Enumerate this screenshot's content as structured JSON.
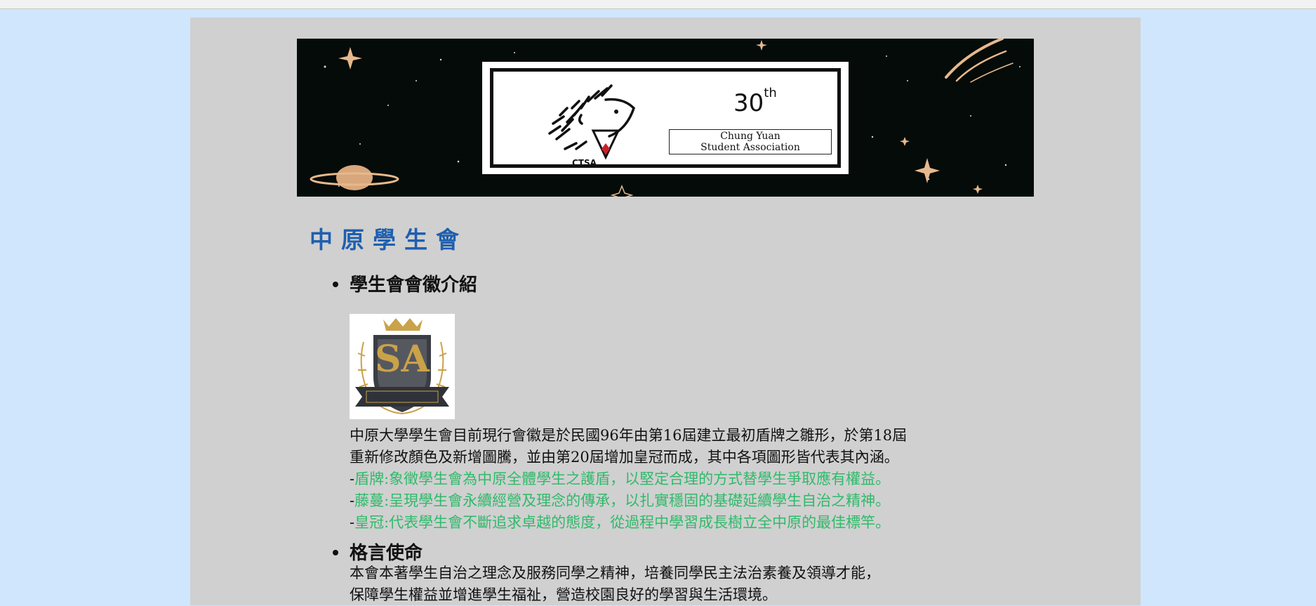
{
  "banner": {
    "anniversary_number": "30",
    "anniversary_suffix": "th",
    "association_line1": "Chung Yuan",
    "association_line2": "Student Association",
    "logo_text": "CTSA"
  },
  "page_title": "中原學生會",
  "sections": [
    {
      "title": "學生會會徽介紹",
      "emblem_letters": "SA",
      "lines": [
        "中原大學學生會目前現行會徽是於民國96年由第16屆建立最初盾牌之雛形，於第18屆",
        "重新修改顏色及新增圖騰，並由第20屆增加皇冠而成，其中各項圖形皆代表其內涵。"
      ],
      "items": [
        {
          "prefix": "-",
          "text": "盾牌:象徵學生會為中原全體學生之護盾，以堅定合理的方式替學生爭取應有權益。"
        },
        {
          "prefix": "-",
          "text": "藤蔓:呈現學生會永續經營及理念的傳承，以扎實穩固的基礎延續學生自治之精神。"
        },
        {
          "prefix": "-",
          "text": "皇冠:代表學生會不斷追求卓越的態度，從過程中學習成長樹立全中原的最佳標竿。"
        }
      ]
    },
    {
      "title": "格言使命",
      "lines": [
        "本會本著學生自治之理念及服務同學之精神，培養同學民主法治素養及領導才能，",
        "保障學生權益並增進學生福祉，營造校園良好的學習與生活環境。"
      ]
    }
  ],
  "colors": {
    "page_background": "#d0e6fd",
    "panel_background": "#d0d0d0",
    "title_blue": "#1f5fae",
    "highlight_green": "#2fba6a"
  }
}
